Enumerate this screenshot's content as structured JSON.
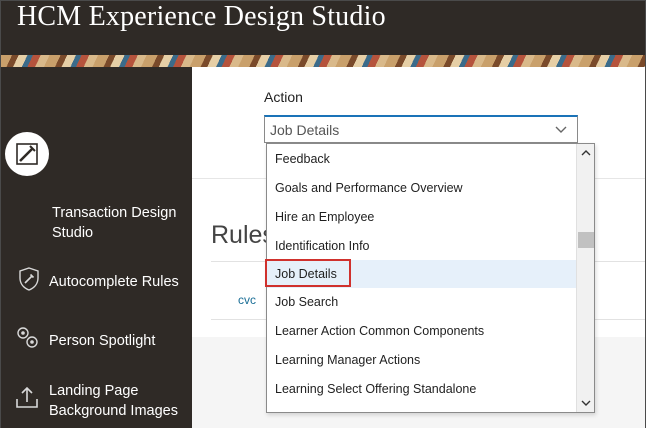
{
  "header": {
    "title": "HCM Experience Design Studio"
  },
  "sidebar": {
    "items": [
      {
        "label_line1": "Transaction Design",
        "label_line2": "Studio",
        "icon": "transaction-design-icon"
      },
      {
        "label_line1": "Autocomplete Rules",
        "label_line2": "",
        "icon": "shield-wrench-icon"
      },
      {
        "label_line1": "Person Spotlight",
        "label_line2": "",
        "icon": "gears-icon"
      },
      {
        "label_line1": "Landing Page",
        "label_line2": "Background Images",
        "icon": "upload-tray-icon"
      }
    ]
  },
  "main": {
    "action_label": "Action",
    "action_value": "Job Details",
    "rules_title": "Rules",
    "row_text": "cvc"
  },
  "dropdown": {
    "options": [
      "Feedback",
      "Goals and Performance Overview",
      "Hire an Employee",
      "Identification Info",
      "Job Details",
      "Job Search",
      "Learner Action Common Components",
      "Learning Manager Actions",
      "Learning Select Offering Standalone"
    ],
    "selected_index": 4
  },
  "colors": {
    "header_bg": "#2f2a26",
    "accent": "#1a73b8",
    "highlight": "#d0312d"
  }
}
